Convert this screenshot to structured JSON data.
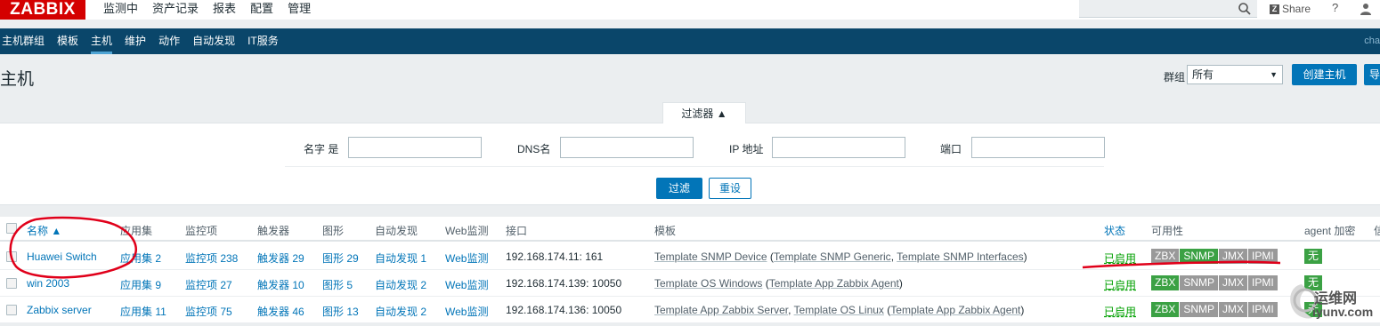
{
  "topbar": {
    "logo": "ZABBIX",
    "menu": [
      "监测中",
      "资产记录",
      "报表",
      "配置",
      "管理"
    ],
    "share": "Share",
    "help": "?"
  },
  "submenu": {
    "items": [
      "主机群组",
      "模板",
      "主机",
      "维护",
      "动作",
      "自动发现",
      "IT服务"
    ],
    "right_text": "cha"
  },
  "header": {
    "title": "主机",
    "group_label": "群组",
    "group_value": "所有",
    "create_button": "创建主机",
    "import_button": "导"
  },
  "filter": {
    "tab_label": "过滤器 ▲",
    "name_label": "名字 是",
    "dns_label": "DNS名",
    "ip_label": "IP 地址",
    "port_label": "端口",
    "filter_button": "过滤",
    "reset_button": "重设"
  },
  "table": {
    "headers": {
      "name": "名称 ▲",
      "applications": "应用集",
      "items": "监控项",
      "triggers": "触发器",
      "graphs": "图形",
      "discovery": "自动发现",
      "web": "Web监测",
      "interface": "接口",
      "templates": "模板",
      "status": "状态",
      "availability": "可用性",
      "encryption": "agent 加密",
      "info": "信"
    },
    "rows": [
      {
        "name": "Huawei Switch",
        "applications": "应用集 2",
        "items": "监控项 238",
        "triggers": "触发器 29",
        "graphs": "图形 29",
        "discovery": "自动发现 1",
        "web": "Web监测",
        "interface": "192.168.174.11: 161",
        "template_main": "Template SNMP Device",
        "template_paren_open": " (",
        "template_sub1": "Template SNMP Generic",
        "template_sep": ", ",
        "template_sub2": "Template SNMP Interfaces",
        "template_paren_close": ")",
        "status": "已启用",
        "encryption": "无"
      },
      {
        "name": "win 2003",
        "applications": "应用集 9",
        "items": "监控项 27",
        "triggers": "触发器 10",
        "graphs": "图形 5",
        "discovery": "自动发现 2",
        "web": "Web监测",
        "interface": "192.168.174.139: 10050",
        "template_main": "Template OS Windows",
        "template_paren_open": " (",
        "template_sub1": "Template App Zabbix Agent",
        "template_paren_close": ")",
        "status": "已启用",
        "encryption": "无"
      },
      {
        "name": "Zabbix server",
        "applications": "应用集 11",
        "items": "监控项 75",
        "triggers": "触发器 46",
        "graphs": "图形 13",
        "discovery": "自动发现 2",
        "web": "Web监测",
        "interface": "192.168.174.136: 10050",
        "template_main": "Template App Zabbix Server",
        "template_sep": ", ",
        "template_sub1": "Template OS Linux",
        "template_paren_open": " (",
        "template_sub2": "Template App Zabbix Agent",
        "template_paren_close": ")",
        "status": "已启用",
        "encryption": "无"
      }
    ],
    "availability_tags": [
      "ZBX",
      "SNMP",
      "JMX",
      "IPMI"
    ]
  },
  "watermark": {
    "text_top": "运维网",
    "text_bottom": "iyunv.com"
  },
  "colors": {
    "brand_red": "#d40000",
    "nav_blue": "#0a466a",
    "link_blue": "#0275b8",
    "status_green": "#00a000",
    "tag_green": "#3ba144",
    "tag_gray": "#999999",
    "annotation_red": "#e0001a"
  }
}
